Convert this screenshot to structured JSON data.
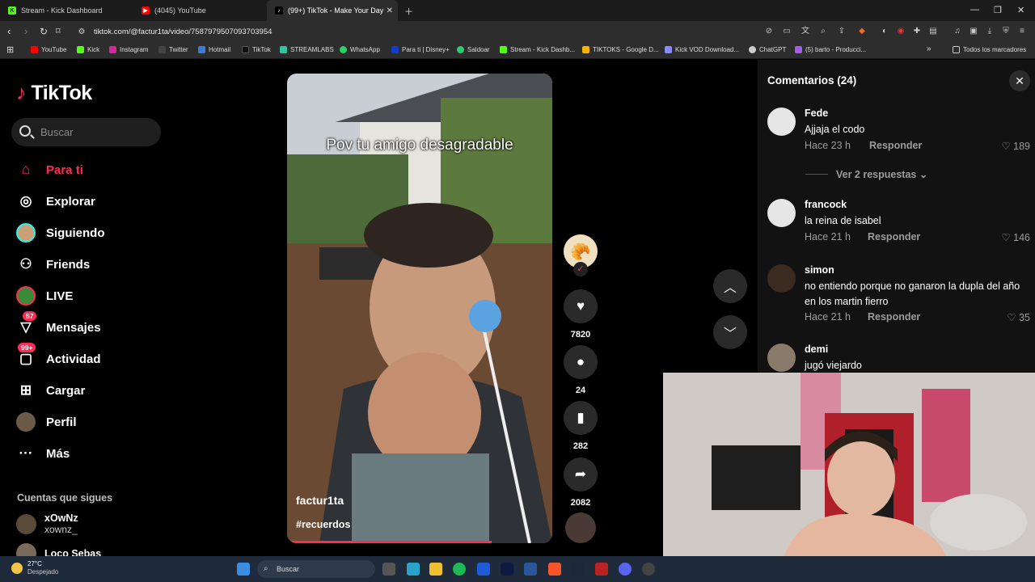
{
  "browser": {
    "tabs": [
      {
        "title": "Stream - Kick Dashboard",
        "icon": "kick-icon"
      },
      {
        "title": "(4045) YouTube",
        "icon": "youtube-icon"
      },
      {
        "title": "(99+) TikTok - Make Your Day",
        "icon": "tiktok-icon"
      }
    ],
    "url": "tiktok.com/@factur1ta/video/7587979507093703954",
    "bookmarks": [
      "YouTube",
      "Kick",
      "Instagram",
      "Twitter",
      "Hotmail",
      "TikTok",
      "STREAMLABS",
      "WhatsApp",
      "Para ti | Disney+",
      "Saldoar",
      "Stream - Kick Dashb...",
      "TIKTOKS - Google D...",
      "Kick VOD Download...",
      "ChatGPT",
      "(5) barto - Producci..."
    ],
    "bookmarks_folder": "Todos los marcadores"
  },
  "sidebar": {
    "logo": "TikTok",
    "search_placeholder": "Buscar",
    "items": [
      {
        "label": "Para ti",
        "icon": "home-icon",
        "active": true
      },
      {
        "label": "Explorar",
        "icon": "compass-icon"
      },
      {
        "label": "Siguiendo",
        "icon": "following-avatar-icon"
      },
      {
        "label": "Friends",
        "icon": "friends-icon"
      },
      {
        "label": "LIVE",
        "icon": "live-icon"
      },
      {
        "label": "Mensajes",
        "icon": "messages-icon",
        "badge": "57"
      },
      {
        "label": "Actividad",
        "icon": "activity-icon",
        "badge": "99+"
      },
      {
        "label": "Cargar",
        "icon": "upload-icon"
      },
      {
        "label": "Perfil",
        "icon": "profile-avatar-icon"
      },
      {
        "label": "Más",
        "icon": "more-icon"
      }
    ],
    "following_title": "Cuentas que sigues",
    "following": [
      {
        "name": "xOwNz",
        "handle": "xownz_"
      },
      {
        "name": "Loco Sebas",
        "handle": ""
      }
    ]
  },
  "video": {
    "overlay_text": "Pov tu amigo desagradable",
    "author": "factur1ta",
    "hashtag": "#recuerdos",
    "progress": 0.77,
    "likes": "7820",
    "comments": "24",
    "saves": "282",
    "shares": "2082"
  },
  "comments": {
    "title": "Comentarios (24)",
    "reply_label": "Responder",
    "view_replies": "Ver 2 respuestas",
    "items": [
      {
        "user": "Fede",
        "text": "Ajjaja el codo",
        "time": "Hace 23 h",
        "likes": "189"
      },
      {
        "user": "francock",
        "text": "la reina de isabel",
        "time": "Hace 21 h",
        "likes": "146"
      },
      {
        "user": "simon",
        "text": "no entiendo porque no ganaron la dupla del año en los martin fierro",
        "time": "Hace 21 h",
        "likes": "35"
      },
      {
        "user": "demi",
        "text": "jugó viejardo",
        "time": "",
        "likes": ""
      }
    ]
  },
  "taskbar": {
    "temperature": "27°C",
    "weather": "Despejado",
    "search_placeholder": "Buscar"
  },
  "colors": {
    "accent": "#fe2c55",
    "bg": "#000000",
    "panel": "#121212"
  }
}
